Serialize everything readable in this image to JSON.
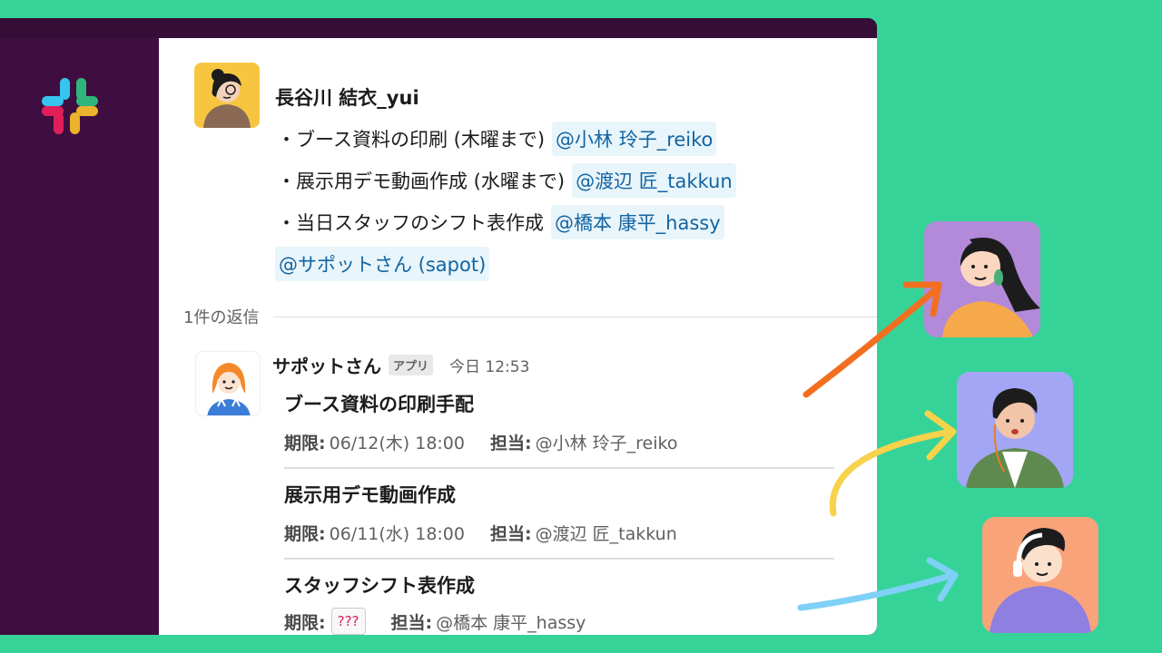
{
  "message": {
    "sender": "長谷川 結衣_yui",
    "lines": [
      {
        "text": "・ブース資料の印刷 (木曜まで)",
        "mention": "@小林 玲子_reiko"
      },
      {
        "text": "・展示用デモ動画作成 (水曜まで)",
        "mention": "@渡辺 匠_takkun"
      },
      {
        "text": "・当日スタッフのシフト表作成",
        "mention": "@橋本 康平_hassy"
      }
    ],
    "bot_mention": "@サポットさん (sapot)"
  },
  "thread": {
    "replies_label": "1件の返信"
  },
  "reply": {
    "sender": "サポットさん",
    "badge": "アプリ",
    "time": "今日 12:53",
    "tasks": [
      {
        "title": "ブース資料の印刷手配",
        "deadline_label": "期限:",
        "deadline": "06/12(木) 18:00",
        "assignee_label": "担当:",
        "assignee": "@小林 玲子_reiko"
      },
      {
        "title": "展示用デモ動画作成",
        "deadline_label": "期限:",
        "deadline": "06/11(水) 18:00",
        "assignee_label": "担当:",
        "assignee": "@渡辺 匠_takkun"
      },
      {
        "title": "スタッフシフト表作成",
        "deadline_label": "期限:",
        "deadline": "???",
        "assignee_label": "担当:",
        "assignee": "@橋本 康平_hassy"
      }
    ]
  },
  "icons": {
    "logo": "slack-logo",
    "sender_avatar": "woman-avatar-icon",
    "bot_avatar": "bot-girl-avatar-icon",
    "ext_avatars": [
      "woman-earrings-avatar-icon",
      "man-green-jacket-avatar-icon",
      "man-headphones-avatar-icon"
    ]
  },
  "colors": {
    "background": "#36d399",
    "sidebar": "#3f0e40",
    "mention_bg": "#e8f5fa",
    "mention_text": "#1264a3",
    "arrow_orange": "#f26f21",
    "arrow_yellow": "#f7d24b",
    "arrow_blue": "#7fd0f5"
  }
}
